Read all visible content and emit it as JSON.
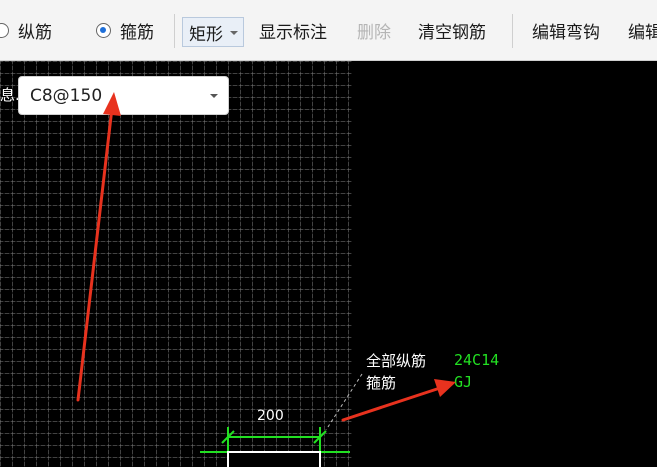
{
  "toolbar": {
    "radio_longitudinal": "纵筋",
    "radio_stirrup": "箍筋",
    "shape_select": "矩形",
    "show_annotation": "显示标注",
    "delete": "删除",
    "clear_rebar": "清空钢筋",
    "edit_hook": "编辑弯钩",
    "edit_partial": "编辑"
  },
  "stirrup_field": {
    "label_fragment": "息.",
    "value": "C8@150"
  },
  "annotation": {
    "all_longitudinal_label": "全部纵筋",
    "all_longitudinal_value": "24C14",
    "stirrup_label": "箍筋",
    "stirrup_value": "GJ",
    "dimension": "200"
  },
  "colors": {
    "arrow": "#e8321e",
    "dimension_line": "#22e022",
    "annotation_value": "#22e022",
    "radio_selected": "#1e6fd9"
  }
}
